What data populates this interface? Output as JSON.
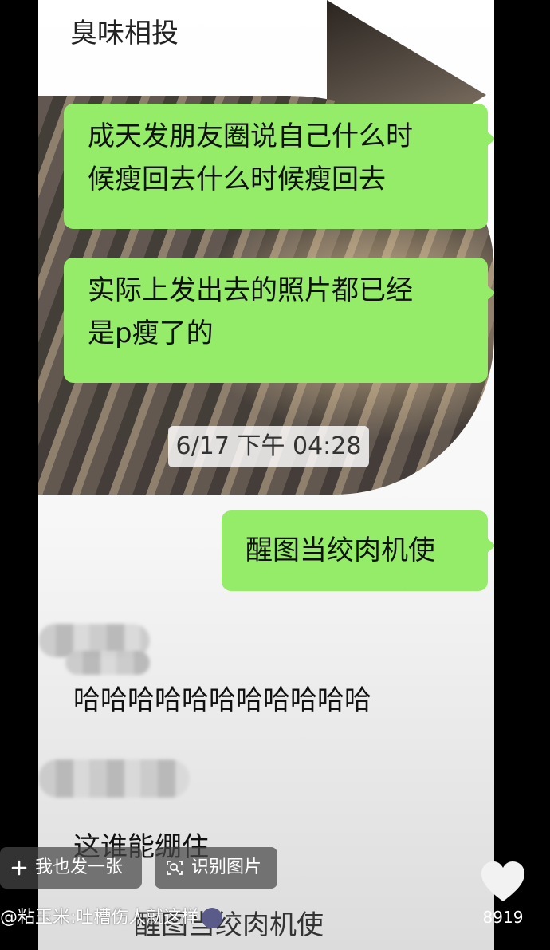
{
  "chat": {
    "title": "臭味相投",
    "messages": [
      {
        "side": "right",
        "text_line1": "成天发朋友圈说自己什么时",
        "text_line2": "候瘦回去什么时候瘦回去"
      },
      {
        "side": "right",
        "text_line1": "实际上发出去的照片都已经",
        "text_line2": "是p瘦了的"
      },
      {
        "side": "right",
        "text": "醒图当绞肉机使"
      }
    ],
    "timestamp": "6/17 下午 04:28",
    "incoming": [
      {
        "text": "哈哈哈哈哈哈哈哈哈哈哈"
      },
      {
        "text": "这谁能绷住"
      },
      {
        "text": "醒图当绞肉机使"
      }
    ]
  },
  "overlay": {
    "upload_label": "我也发一张",
    "recognize_label": "识别图片",
    "caption": "@粘玉米:吐槽伤人就这样",
    "like_count": "8919"
  },
  "colors": {
    "bubble_green": "#95ec69",
    "background": "#000000"
  },
  "icons": [
    "plus-icon",
    "scan-image-icon",
    "heart-icon",
    "emoji-icon"
  ]
}
